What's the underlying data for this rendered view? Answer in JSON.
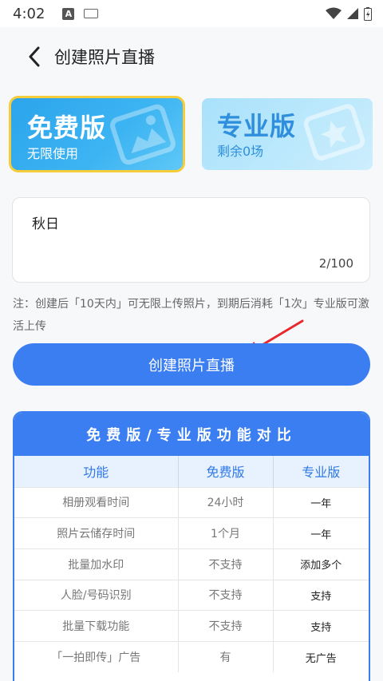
{
  "status": {
    "time": "4:02",
    "notif_a": "A"
  },
  "nav": {
    "title": "创建照片直播"
  },
  "plans": {
    "free": {
      "name": "免费版",
      "sub": "无限使用"
    },
    "pro": {
      "name": "专业版",
      "sub": "剩余0场"
    }
  },
  "input": {
    "value": "秋日",
    "counter": "2/100"
  },
  "note": "注：创建后「10天内」可无限上传照片，到期后消耗「1次」专业版可激活上传",
  "create_button": "创建照片直播",
  "compare": {
    "title": "免费版/专业版功能对比",
    "headers": [
      "功能",
      "免费版",
      "专业版"
    ],
    "rows": [
      [
        "相册观看时间",
        "24小时",
        "一年"
      ],
      [
        "照片云储存时间",
        "1个月",
        "一年"
      ],
      [
        "批量加水印",
        "不支持",
        "添加多个"
      ],
      [
        "人脸/号码识别",
        "不支持",
        "支持"
      ],
      [
        "批量下载功能",
        "不支持",
        "支持"
      ],
      [
        "「一拍即传」广告",
        "有",
        "无广告"
      ]
    ]
  },
  "colors": {
    "accent": "#3b7ef2",
    "free_border": "#f5cc3a",
    "pro_bg": "#bde9fc",
    "arrow": "#e8282b"
  }
}
